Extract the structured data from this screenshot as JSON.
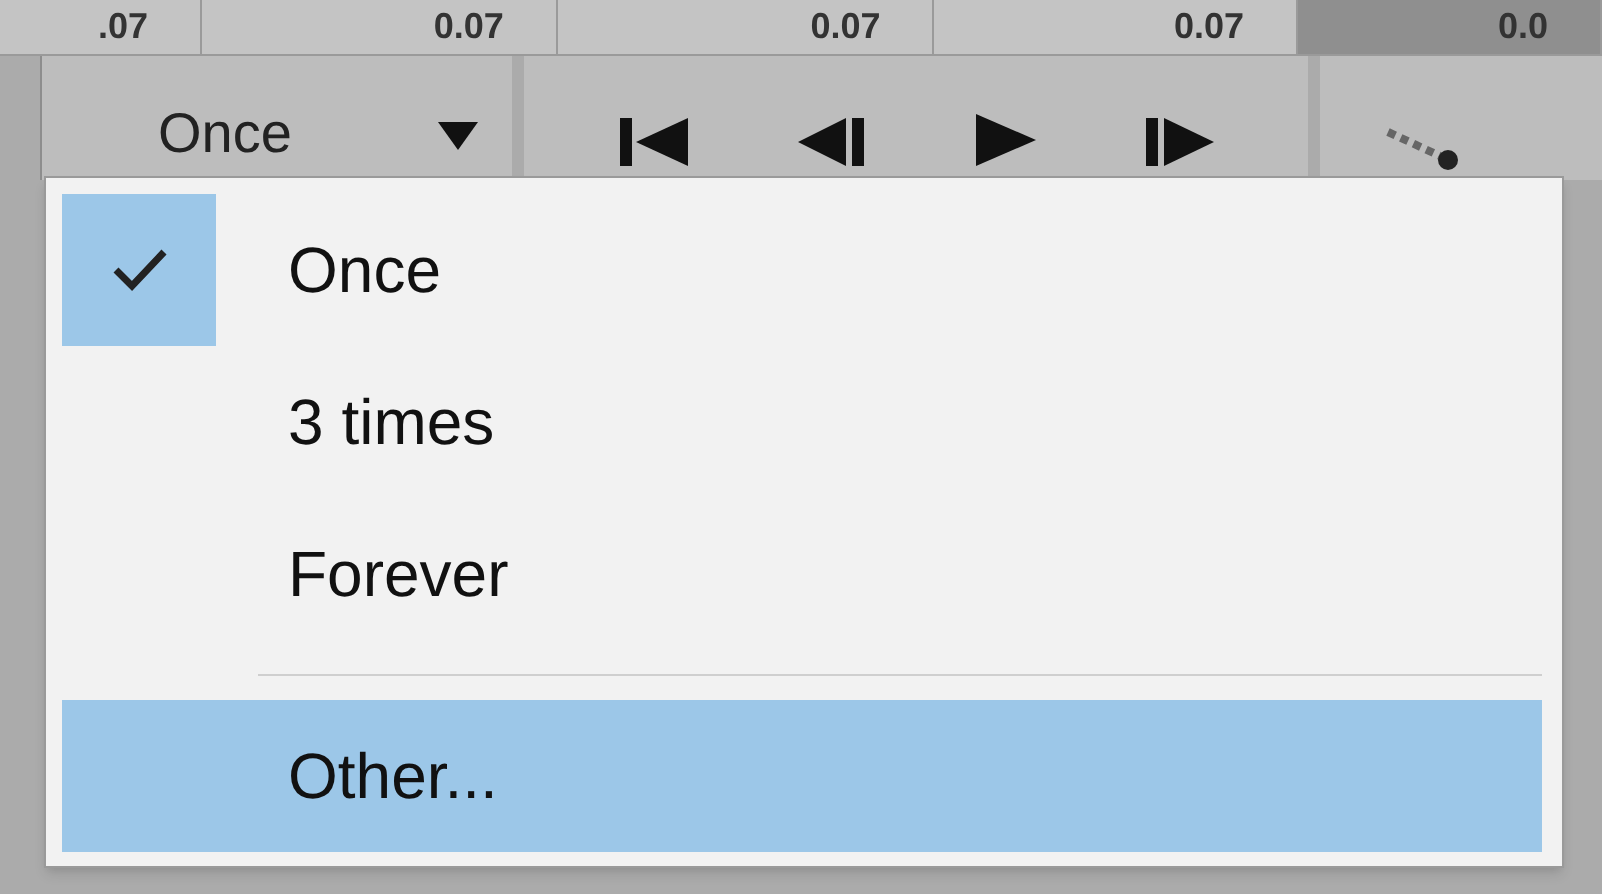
{
  "frames": [
    {
      "delay": ".07",
      "selected": false
    },
    {
      "delay": "0.07",
      "selected": false
    },
    {
      "delay": "0.07",
      "selected": false
    },
    {
      "delay": "0.07",
      "selected": false
    },
    {
      "delay": "0.0",
      "selected": true
    }
  ],
  "loop_dropdown": {
    "value": "Once"
  },
  "menu": {
    "items": [
      {
        "label": "Once",
        "checked": true,
        "selected": false
      },
      {
        "label": "3 times",
        "checked": false,
        "selected": false
      },
      {
        "label": "Forever",
        "checked": false,
        "selected": false
      },
      {
        "kind": "separator"
      },
      {
        "label": "Other...",
        "checked": false,
        "selected": true
      }
    ]
  }
}
